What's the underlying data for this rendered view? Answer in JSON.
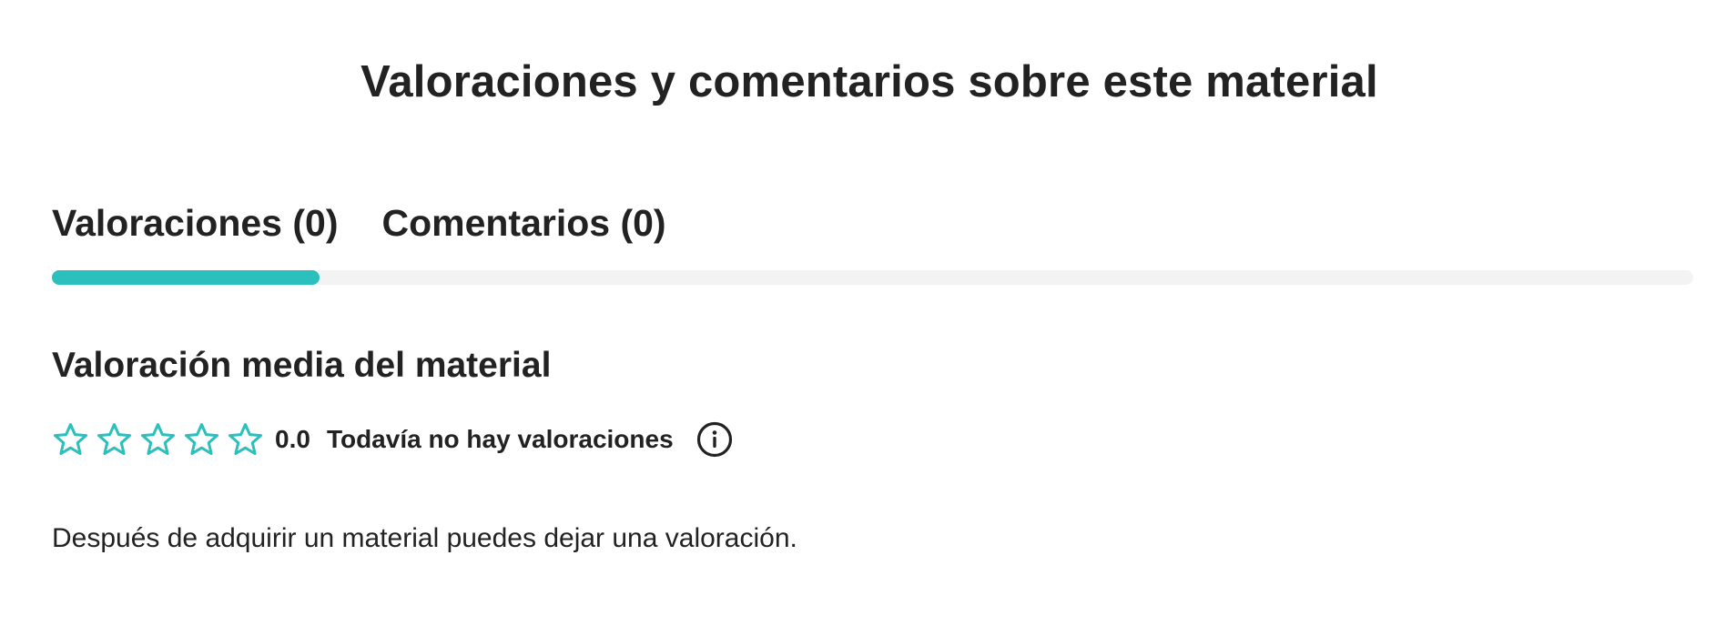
{
  "page_title": "Valoraciones y comentarios sobre este material",
  "tabs": [
    {
      "label": "Valoraciones (0)",
      "active": true
    },
    {
      "label": "Comentarios (0)",
      "active": false
    }
  ],
  "rating_section": {
    "heading": "Valoración media del material",
    "stars_filled": 0,
    "stars_total": 5,
    "score": "0.0",
    "status_text": "Todavía no hay valoraciones",
    "info_icon": "info-circle-icon",
    "star_icon": "star-outline-icon"
  },
  "note": "Después de adquirir un material puedes dejar una valoración.",
  "colors": {
    "accent": "#2bbfbd",
    "text": "#222222",
    "track": "#f3f3f3"
  }
}
